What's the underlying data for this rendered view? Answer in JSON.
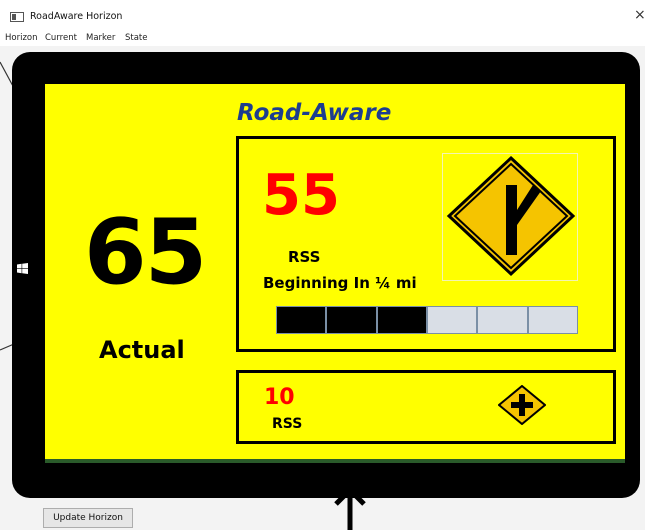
{
  "window": {
    "title": "RoadAware Horizon",
    "close_glyph": "×"
  },
  "menu": {
    "items": [
      "Horizon",
      "Current",
      "Marker",
      "State"
    ]
  },
  "display": {
    "app_name": "Road-Aware",
    "actual_speed": "65",
    "actual_label": "Actual",
    "main_panel": {
      "rss_speed": "55",
      "rss_label": "RSS",
      "distance_label": "Beginning In ¼ mi",
      "sign_icon": "side-road-right-warning-sign",
      "progress": {
        "filled_segments": 3,
        "total_segments": 6,
        "filled_color": "#000000",
        "empty_color": "#d9dee6"
      }
    },
    "secondary_panel": {
      "rss_speed": "10",
      "rss_label": "RSS",
      "sign_icon": "crossroad-warning-sign"
    }
  },
  "colors": {
    "screen_background": "#ffff00",
    "speed_red": "#ff0000",
    "title_blue": "#1d3d8f",
    "sign_yellow": "#f5c400"
  },
  "buttons": {
    "update_horizon": "Update Horizon"
  }
}
